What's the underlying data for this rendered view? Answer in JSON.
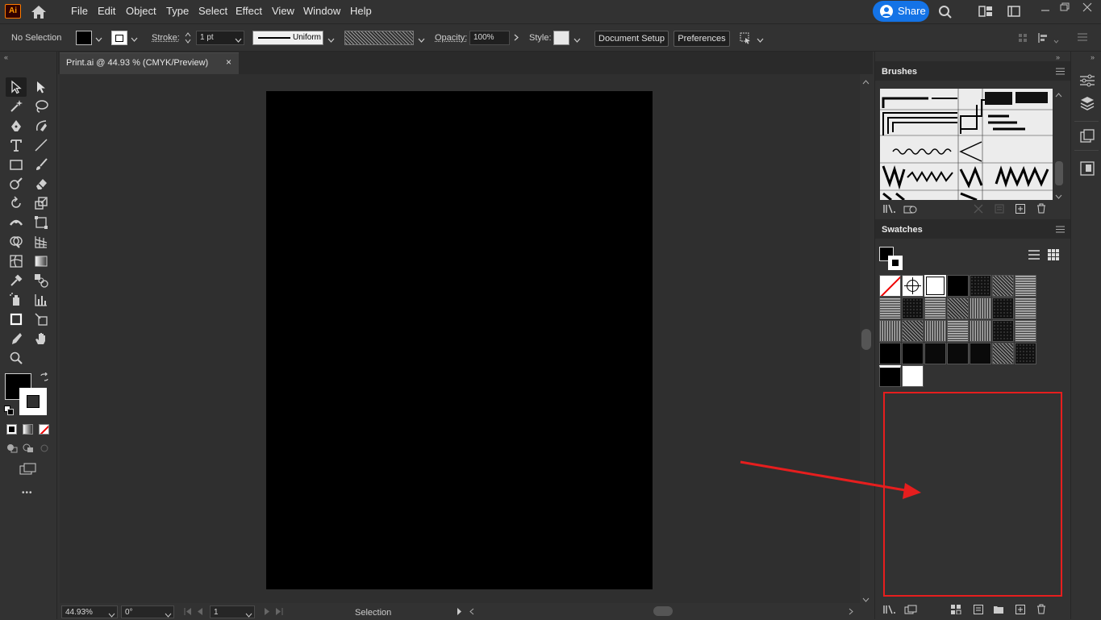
{
  "app": {
    "logo_text": "Ai"
  },
  "menu": [
    "File",
    "Edit",
    "Object",
    "Type",
    "Select",
    "Effect",
    "View",
    "Window",
    "Help"
  ],
  "share": {
    "label": "Share"
  },
  "control": {
    "selection": "No Selection",
    "stroke_label": "Stroke:",
    "stroke_weight": "1 pt",
    "stroke_profile": "Uniform",
    "opacity_label": "Opacity:",
    "opacity_value": "100%",
    "style_label": "Style:",
    "document_setup": "Document Setup",
    "preferences": "Preferences"
  },
  "document": {
    "tab_title": "Print.ai @ 44.93 % (CMYK/Preview)",
    "close": "×"
  },
  "status": {
    "zoom": "44.93%",
    "rotation": "0°",
    "artboard": "1",
    "tool": "Selection"
  },
  "panels": {
    "brushes_title": "Brushes",
    "swatches_title": "Swatches"
  },
  "toolbar": {
    "more": "•••"
  },
  "colors": {
    "accent": "#1473e6",
    "highlight": "#e61e1e",
    "artboard": "#000000"
  }
}
